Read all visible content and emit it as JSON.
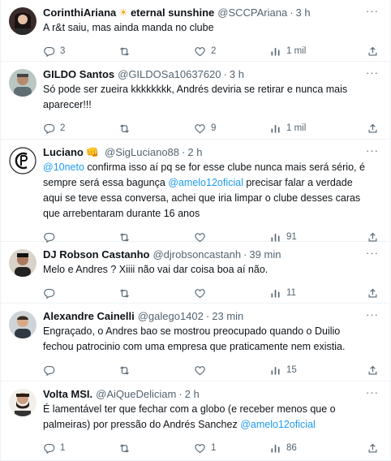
{
  "tweets": [
    {
      "name": "CorinthiAriana",
      "name_suffix": "eternal sunshine",
      "emoji": "☀",
      "handle": "@SCCPAriana",
      "time": "3 h",
      "text": "A r&t saiu, mas ainda manda no clube",
      "replies": "3",
      "retweets": "",
      "likes": "2",
      "views": "1 mil"
    },
    {
      "name": "GILDO Santos",
      "handle": "@GILDOSa10637620",
      "time": "3 h",
      "text": "Só pode ser zueira kkkkkkkk, Andrés deviria se retirar e nunca mais aparecer!!!",
      "replies": "2",
      "retweets": "",
      "likes": "9",
      "views": "1 mil"
    },
    {
      "name": "Luciano",
      "emoji": "👊",
      "handle": "@SigLuciano88",
      "time": "2 h",
      "mention1": "@10neto",
      "text1": " confirma isso aí pq se for esse clube nunca mais será sério, é sempre será essa bagunça ",
      "mention2": "@amelo12oficial",
      "text2": " precisar falar a verdade aqui se teve essa conversa, achei que iria limpar o clube desses caras que arrebentaram durante 16 anos",
      "replies": "",
      "retweets": "",
      "likes": "",
      "views": "91"
    },
    {
      "name": "DJ Robson Castanho",
      "handle": "@djrobsoncastanh",
      "time": "39 min",
      "text": "Melo e Andres ? Xiiii não vai dar coisa boa aí não.",
      "replies": "",
      "retweets": "",
      "likes": "",
      "views": "11"
    },
    {
      "name": "Alexandre Cainelli",
      "handle": "@galego1402",
      "time": "23 min",
      "text": "Engraçado, o Andres bao se mostrou preocupado quando o Duilio fechou patrocinio com uma empresa que praticamente nem existia.",
      "replies": "",
      "retweets": "",
      "likes": "",
      "views": "15"
    },
    {
      "name": "Volta MSI.",
      "handle": "@AiQueDeliciam",
      "time": "2 h",
      "text1": "É lamentável ter que fechar com a globo (e receber menos que o palmeiras) por pressão do Andrés Sanchez ",
      "mention1": "@amelo12oficial",
      "replies": "1",
      "retweets": "",
      "likes": "1",
      "views": "86"
    }
  ],
  "ui": {
    "dot": "·",
    "more": "···"
  },
  "colors": {
    "accent": "#1d9bf0",
    "muted": "#536471",
    "text": "#0f1419",
    "divider": "#eff3f4"
  },
  "icons": [
    "reply-icon",
    "retweet-icon",
    "like-icon",
    "views-icon",
    "share-icon",
    "more-icon"
  ]
}
